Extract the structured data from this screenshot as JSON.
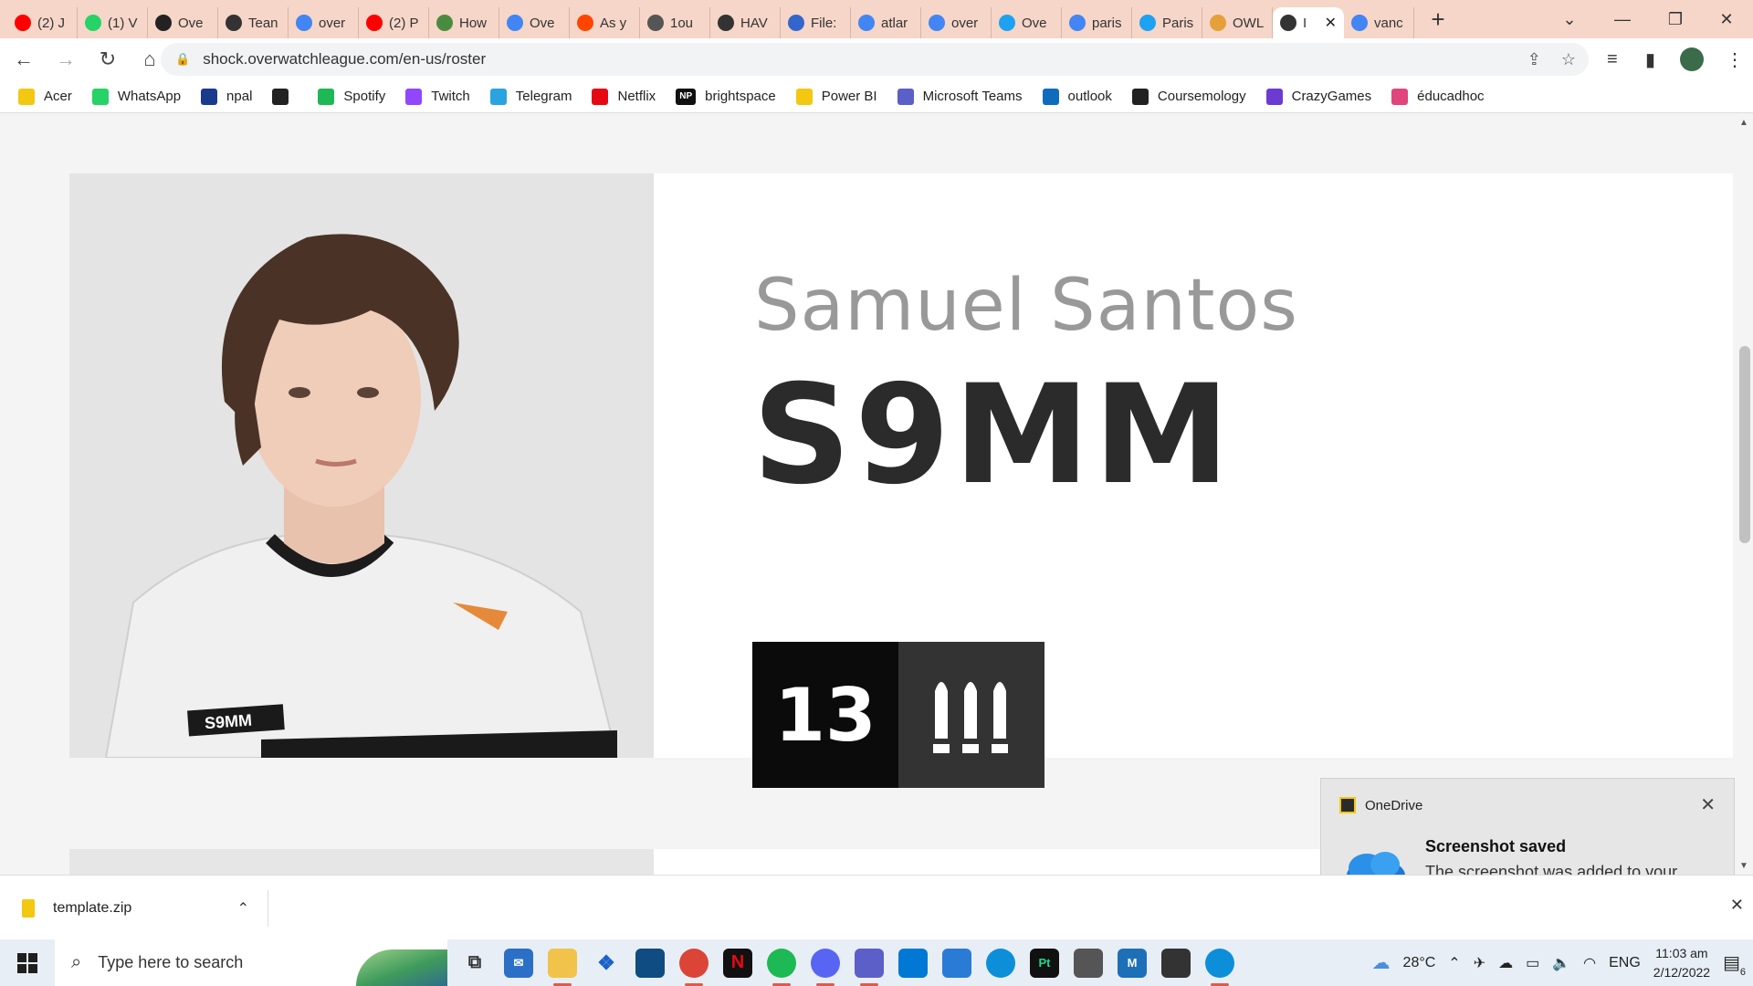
{
  "browser": {
    "tabs": [
      {
        "label": "(2) J",
        "icon": "youtube-icon",
        "color": "#ff0000"
      },
      {
        "label": "(1) V",
        "icon": "whatsapp-icon",
        "color": "#25d366"
      },
      {
        "label": "Ove",
        "icon": "overwatch-icon",
        "color": "#222222"
      },
      {
        "label": "Tean",
        "icon": "team-icon",
        "color": "#333333"
      },
      {
        "label": "over",
        "icon": "google-icon",
        "color": "#4285f4"
      },
      {
        "label": "(2) P",
        "icon": "youtube-icon",
        "color": "#ff0000"
      },
      {
        "label": "How",
        "icon": "wikihow-icon",
        "color": "#4a8c3f"
      },
      {
        "label": "Ove",
        "icon": "google-icon",
        "color": "#4285f4"
      },
      {
        "label": "As y",
        "icon": "reddit-icon",
        "color": "#ff4500"
      },
      {
        "label": "1ou",
        "icon": "globe-icon",
        "color": "#555555"
      },
      {
        "label": "HAV",
        "icon": "team-icon",
        "color": "#333333"
      },
      {
        "label": "File:",
        "icon": "file-icon",
        "color": "#3366cc"
      },
      {
        "label": "atlar",
        "icon": "google-icon",
        "color": "#4285f4"
      },
      {
        "label": "over",
        "icon": "google-icon",
        "color": "#4285f4"
      },
      {
        "label": "Ove",
        "icon": "twitter-icon",
        "color": "#1da1f2"
      },
      {
        "label": "paris",
        "icon": "google-icon",
        "color": "#4285f4"
      },
      {
        "label": "Paris",
        "icon": "twitter-icon",
        "color": "#1da1f2"
      },
      {
        "label": "OWL",
        "icon": "owl-icon",
        "color": "#e5a03a"
      },
      {
        "label": "I",
        "icon": "team-icon",
        "color": "#333333"
      },
      {
        "label": "vanc",
        "icon": "google-icon",
        "color": "#4285f4"
      }
    ],
    "active_tab_index": 18,
    "url": "shock.overwatchleague.com/en-us/roster"
  },
  "bookmarks": [
    {
      "label": "Acer",
      "color": "#f2c811"
    },
    {
      "label": "WhatsApp",
      "color": "#25d366"
    },
    {
      "label": "npal",
      "color": "#1a3a8c"
    },
    {
      "label": "",
      "color": "#222222"
    },
    {
      "label": "Spotify",
      "color": "#1db954"
    },
    {
      "label": "Twitch",
      "color": "#9146ff"
    },
    {
      "label": "Telegram",
      "color": "#2aa3df"
    },
    {
      "label": "Netflix",
      "color": "#e50914"
    },
    {
      "label": "brightspace",
      "color": "#111111",
      "prefix": "NP"
    },
    {
      "label": "Power BI",
      "color": "#f2c811"
    },
    {
      "label": "Microsoft Teams",
      "color": "#5b5fc7"
    },
    {
      "label": "outlook",
      "color": "#0f6cbd"
    },
    {
      "label": "Coursemology",
      "color": "#222222"
    },
    {
      "label": "CrazyGames",
      "color": "#6c3bd1"
    },
    {
      "label": "éducadhoc",
      "color": "#e0457b"
    }
  ],
  "player": {
    "real_name": "Samuel Santos",
    "handle": "S9MM",
    "number": "13",
    "role_icon": "damage-role-icon",
    "jersey_text": "S9MM"
  },
  "toast": {
    "app": "OneDrive",
    "title": "Screenshot saved",
    "body": "The screenshot was added to your OneDrive."
  },
  "downloads": {
    "file": "template.zip"
  },
  "taskbar": {
    "search_placeholder": "Type here to search",
    "weather": "28°C",
    "lang": "ENG",
    "time": "11:03 am",
    "date": "2/12/2022",
    "notif_count": "6"
  }
}
